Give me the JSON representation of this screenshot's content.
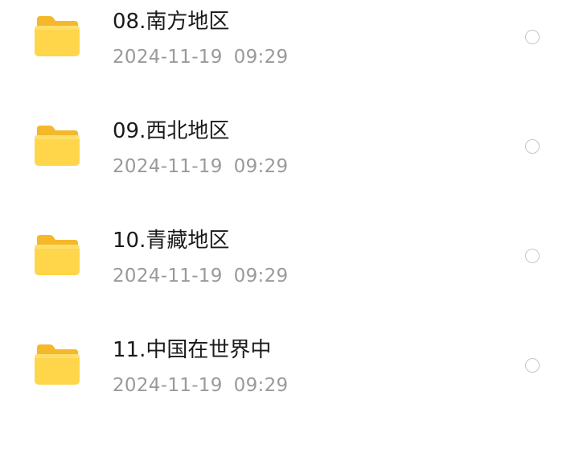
{
  "files": [
    {
      "name": "08.南方地区",
      "date": "2024-11-19",
      "time": "09:29",
      "icon": "folder-icon"
    },
    {
      "name": "09.西北地区",
      "date": "2024-11-19",
      "time": "09:29",
      "icon": "folder-icon"
    },
    {
      "name": "10.青藏地区",
      "date": "2024-11-19",
      "time": "09:29",
      "icon": "folder-icon"
    },
    {
      "name": "11.中国在世界中",
      "date": "2024-11-19",
      "time": "09:29",
      "icon": "folder-icon"
    }
  ],
  "colors": {
    "folder_body": "#FFD54A",
    "folder_tab": "#F5B82A",
    "title_text": "#1a1a1a",
    "meta_text": "#9a9a9a"
  }
}
